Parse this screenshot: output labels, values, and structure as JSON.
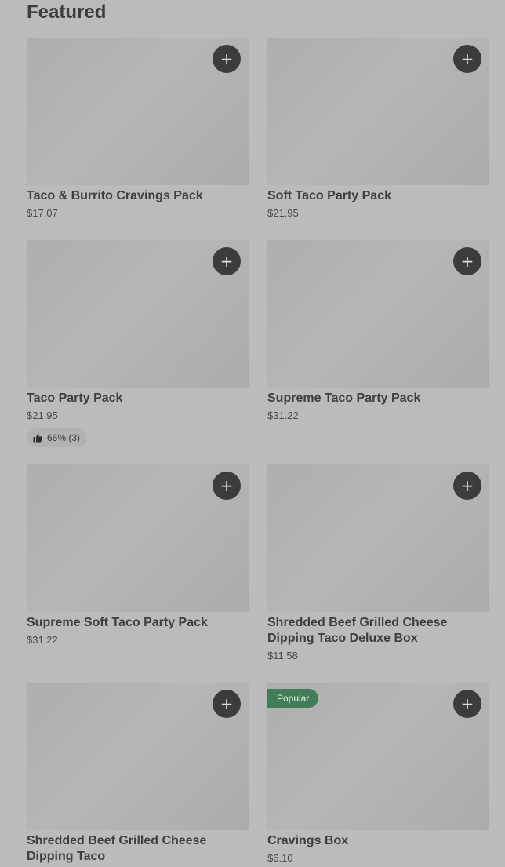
{
  "section": {
    "title": "Featured"
  },
  "add_icon": "plus-icon",
  "cards": [
    {
      "name": "Taco & Burrito Cravings Pack",
      "price": "$17.07"
    },
    {
      "name": "Soft Taco Party Pack",
      "price": "$21.95"
    },
    {
      "name": "Taco Party Pack",
      "price": "$21.95",
      "rating": "66% (3)"
    },
    {
      "name": "Supreme Taco Party Pack",
      "price": "$31.22"
    },
    {
      "name": "Supreme Soft Taco Party Pack",
      "price": "$31.22"
    },
    {
      "name": "Shredded Beef Grilled Cheese Dipping Taco Deluxe Box",
      "price": "$11.58"
    },
    {
      "name": "Shredded Beef Grilled Cheese Dipping Taco",
      "price": ""
    },
    {
      "name": "Cravings Box",
      "price": "$6.10",
      "badge": "Popular"
    }
  ]
}
